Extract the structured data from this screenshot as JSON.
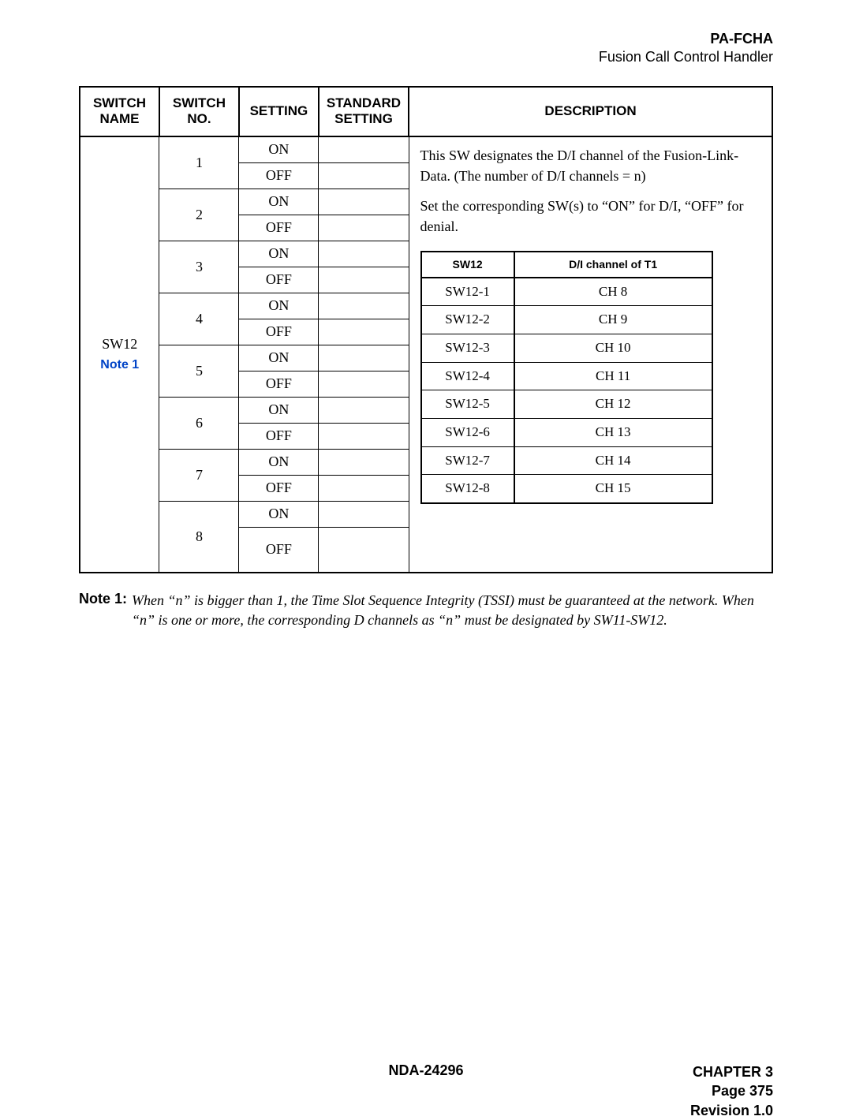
{
  "header": {
    "code": "PA-FCHA",
    "title": "Fusion Call Control Handler"
  },
  "table": {
    "headers": {
      "switch_name": "SWITCH NAME",
      "switch_no": "SWITCH NO.",
      "setting": "SETTING",
      "std_setting": "STANDARD SETTING",
      "description": "DESCRIPTION"
    },
    "switch_name": "SW12",
    "note_link": "Note 1",
    "switch_nos": [
      "1",
      "2",
      "3",
      "4",
      "5",
      "6",
      "7",
      "8"
    ],
    "on": "ON",
    "off": "OFF",
    "desc_p1": "This SW designates the D/I channel of the Fusion-Link-Data.   (The number of D/I channels = n)",
    "desc_p2": "Set the corresponding SW(s) to “ON” for D/I, “OFF” for denial.",
    "inner": {
      "h1": "SW12",
      "h2": "D/I channel of T1",
      "rows": [
        {
          "a": "SW12-1",
          "b": "CH 8"
        },
        {
          "a": "SW12-2",
          "b": "CH 9"
        },
        {
          "a": "SW12-3",
          "b": "CH 10"
        },
        {
          "a": "SW12-4",
          "b": "CH 11"
        },
        {
          "a": "SW12-5",
          "b": "CH 12"
        },
        {
          "a": "SW12-6",
          "b": "CH 13"
        },
        {
          "a": "SW12-7",
          "b": "CH 14"
        },
        {
          "a": "SW12-8",
          "b": "CH 15"
        }
      ]
    }
  },
  "note": {
    "label": "Note 1:",
    "text": "When “n” is bigger than 1, the Time Slot Sequence Integrity (TSSI) must be guaranteed at the network. When “n” is one or more, the corresponding D channels as “n” must be designated by SW11-SW12."
  },
  "footer": {
    "doc": "NDA-24296",
    "chapter": "CHAPTER 3",
    "page": "Page 375",
    "rev": "Revision 1.0"
  }
}
